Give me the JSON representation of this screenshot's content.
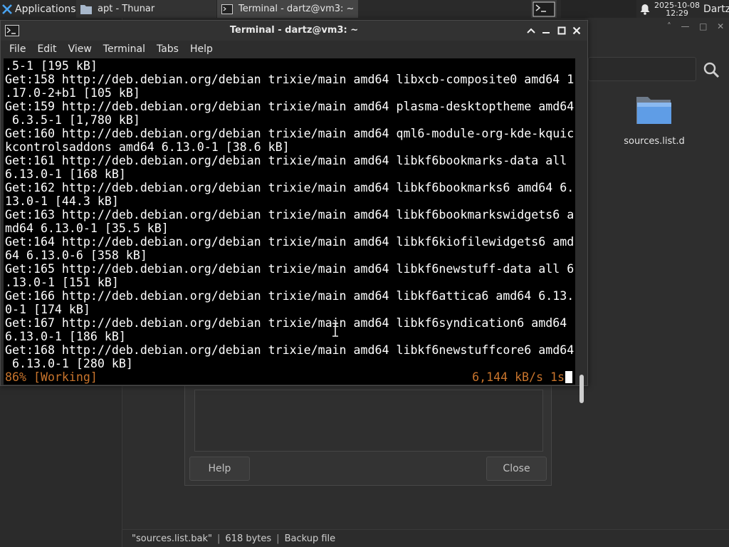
{
  "panel": {
    "applications_label": "Applications",
    "tasks": [
      {
        "label": "apt - Thunar"
      },
      {
        "label": "Terminal - dartz@vm3: ~"
      }
    ],
    "clock_date": "2025-10-08",
    "clock_time": "12:29",
    "user_label": "Dartz"
  },
  "thunar": {
    "folder_label": "sources.list.d",
    "status": {
      "filename": "\"sources.list.bak\"",
      "size": "618 bytes",
      "type": "Backup file"
    },
    "dialog": {
      "help_label": "Help",
      "close_label": "Close"
    }
  },
  "terminal": {
    "title": "Terminal - dartz@vm3: ~",
    "menu": [
      "File",
      "Edit",
      "View",
      "Terminal",
      "Tabs",
      "Help"
    ],
    "lines": [
      ".5-1 [195 kB]",
      "Get:158 http://deb.debian.org/debian trixie/main amd64 libxcb-composite0 amd64 1",
      ".17.0-2+b1 [105 kB]",
      "Get:159 http://deb.debian.org/debian trixie/main amd64 plasma-desktoptheme amd64",
      " 6.3.5-1 [1,780 kB]",
      "Get:160 http://deb.debian.org/debian trixie/main amd64 qml6-module-org-kde-kquic",
      "kcontrolsaddons amd64 6.13.0-1 [38.6 kB]",
      "Get:161 http://deb.debian.org/debian trixie/main amd64 libkf6bookmarks-data all",
      "6.13.0-1 [168 kB]",
      "Get:162 http://deb.debian.org/debian trixie/main amd64 libkf6bookmarks6 amd64 6.",
      "13.0-1 [44.3 kB]",
      "Get:163 http://deb.debian.org/debian trixie/main amd64 libkf6bookmarkswidgets6 a",
      "md64 6.13.0-1 [35.5 kB]",
      "Get:164 http://deb.debian.org/debian trixie/main amd64 libkf6kiofilewidgets6 amd",
      "64 6.13.0-6 [358 kB]",
      "Get:165 http://deb.debian.org/debian trixie/main amd64 libkf6newstuff-data all 6",
      ".13.0-1 [151 kB]",
      "Get:166 http://deb.debian.org/debian trixie/main amd64 libkf6attica6 amd64 6.13.",
      "0-1 [174 kB]",
      "Get:167 http://deb.debian.org/debian trixie/main amd64 libkf6syndication6 amd64",
      "6.13.0-1 [186 kB]",
      "Get:168 http://deb.debian.org/debian trixie/main amd64 libkf6newstuffcore6 amd64",
      " 6.13.0-1 [280 kB]"
    ],
    "status_left": "86% [Working]",
    "status_right": "6,144 kB/s 1s",
    "status_color": "#c8742c"
  }
}
